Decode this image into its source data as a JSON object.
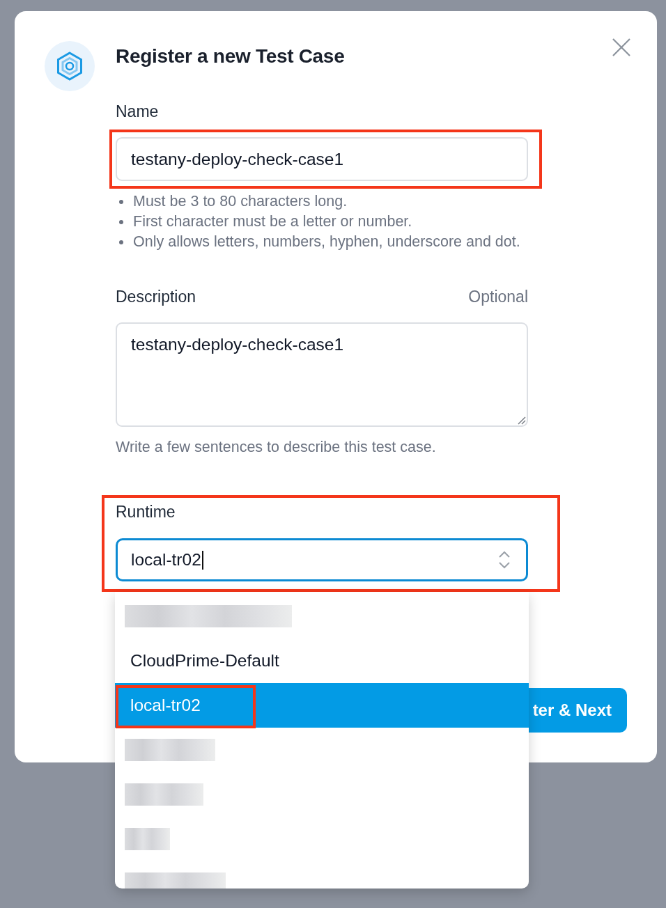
{
  "dialog": {
    "title": "Register a new Test Case"
  },
  "fields": [
    {
      "kind": "input",
      "label": "Name",
      "value": "testany-deploy-check-case1",
      "highlighted": true,
      "hints": [
        "Must be 3 to 80 characters long.",
        "First character must be a letter or number.",
        "Only allows letters, numbers, hyphen, underscore and dot."
      ]
    },
    {
      "kind": "textarea",
      "label": "Description",
      "optional_label": "Optional",
      "value": "testany-deploy-check-case1",
      "help": "Write a few sentences to describe this test case.",
      "highlighted": false
    },
    {
      "kind": "select",
      "label": "Runtime",
      "value": "local-tr02",
      "focused": true,
      "expanded": true,
      "highlighted": true,
      "options": [
        {
          "kind": "redacted"
        },
        {
          "kind": "text",
          "label": "CloudPrime-Default",
          "selected": false,
          "highlighted": false
        },
        {
          "kind": "text",
          "label": "local-tr02",
          "selected": true,
          "highlighted": true
        },
        {
          "kind": "redacted"
        },
        {
          "kind": "redacted"
        },
        {
          "kind": "redacted"
        },
        {
          "kind": "redacted"
        }
      ]
    }
  ],
  "footer": {
    "button": {
      "label": "ter & Next"
    }
  }
}
